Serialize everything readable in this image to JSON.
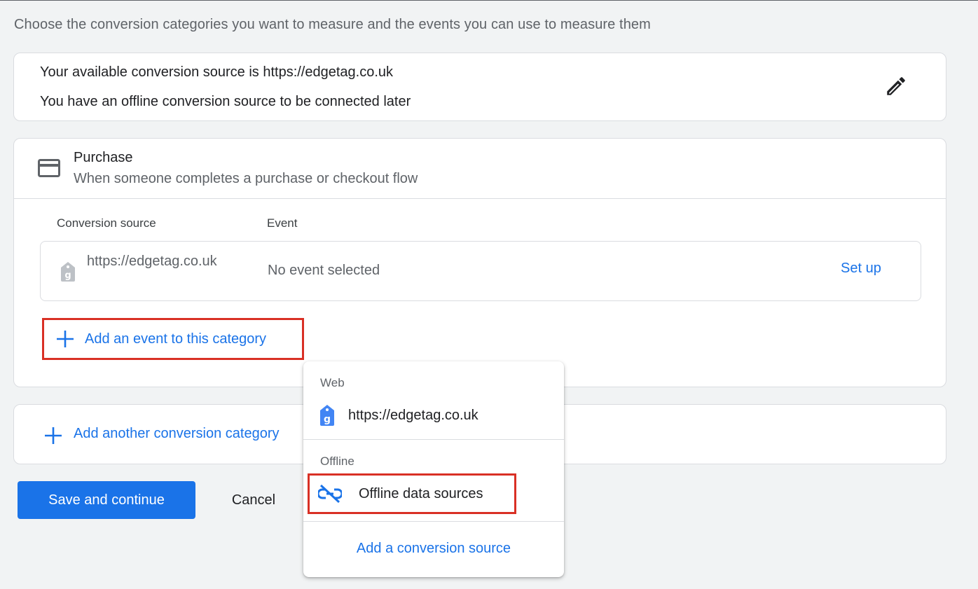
{
  "page": {
    "intro": "Choose the conversion categories you want to measure and the events you can use to measure them"
  },
  "source_summary": {
    "line1": "Your available conversion source is https://edgetag.co.uk",
    "line2": "You have an offline conversion source to be connected later",
    "edit_icon": "pencil-icon"
  },
  "category": {
    "icon": "credit-card-icon",
    "title": "Purchase",
    "description": "When someone completes a purchase or checkout flow",
    "columns": {
      "source": "Conversion source",
      "event": "Event"
    },
    "rows": [
      {
        "icon": "google-tag-icon",
        "source": "https://edgetag.co.uk",
        "event": "No event selected",
        "action": "Set up"
      }
    ],
    "add_event_label": "Add an event to this category"
  },
  "add_category": {
    "label": "Add another conversion category"
  },
  "actions": {
    "save": "Save and continue",
    "cancel": "Cancel"
  },
  "menu": {
    "sections": [
      {
        "label": "Web",
        "items": [
          {
            "icon": "google-tag-icon",
            "label": "https://edgetag.co.uk"
          }
        ]
      },
      {
        "label": "Offline",
        "items": [
          {
            "icon": "link-off-icon",
            "label": "Offline data sources"
          }
        ]
      }
    ],
    "footer_action": "Add a conversion source"
  },
  "colors": {
    "accent": "#1a73e8",
    "highlight_border": "#d93025",
    "background": "#f1f3f4"
  }
}
